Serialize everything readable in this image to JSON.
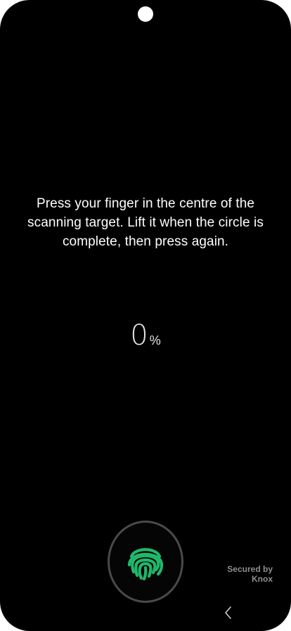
{
  "instruction": {
    "text": "Press your finger in the centre of the scanning target. Lift it when the circle is complete, then press again."
  },
  "progress": {
    "value": "0",
    "unit": "%"
  },
  "scanner": {
    "icon": "fingerprint-icon",
    "icon_color": "#1fb86b",
    "ring_color": "#4a4a4a"
  },
  "footer": {
    "secured_line1": "Secured by",
    "secured_line2": "Knox"
  },
  "navigation": {
    "back_icon": "chevron-left-icon"
  },
  "colors": {
    "background": "#000000",
    "text": "#ffffff",
    "muted": "#8f8f8f"
  }
}
